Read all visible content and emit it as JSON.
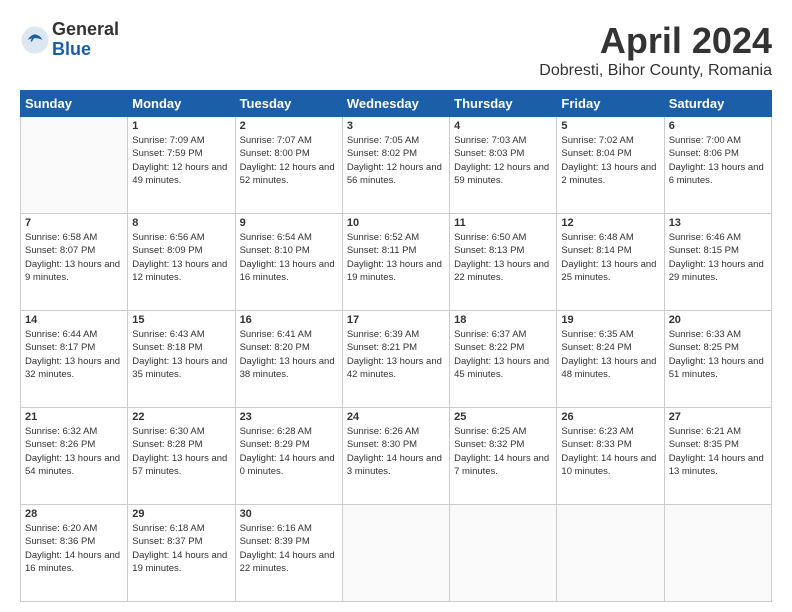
{
  "header": {
    "logo_general": "General",
    "logo_blue": "Blue",
    "title": "April 2024",
    "location": "Dobresti, Bihor County, Romania"
  },
  "days_of_week": [
    "Sunday",
    "Monday",
    "Tuesday",
    "Wednesday",
    "Thursday",
    "Friday",
    "Saturday"
  ],
  "weeks": [
    [
      {
        "day": "",
        "sunrise": "",
        "sunset": "",
        "daylight": ""
      },
      {
        "day": "1",
        "sunrise": "Sunrise: 7:09 AM",
        "sunset": "Sunset: 7:59 PM",
        "daylight": "Daylight: 12 hours and 49 minutes."
      },
      {
        "day": "2",
        "sunrise": "Sunrise: 7:07 AM",
        "sunset": "Sunset: 8:00 PM",
        "daylight": "Daylight: 12 hours and 52 minutes."
      },
      {
        "day": "3",
        "sunrise": "Sunrise: 7:05 AM",
        "sunset": "Sunset: 8:02 PM",
        "daylight": "Daylight: 12 hours and 56 minutes."
      },
      {
        "day": "4",
        "sunrise": "Sunrise: 7:03 AM",
        "sunset": "Sunset: 8:03 PM",
        "daylight": "Daylight: 12 hours and 59 minutes."
      },
      {
        "day": "5",
        "sunrise": "Sunrise: 7:02 AM",
        "sunset": "Sunset: 8:04 PM",
        "daylight": "Daylight: 13 hours and 2 minutes."
      },
      {
        "day": "6",
        "sunrise": "Sunrise: 7:00 AM",
        "sunset": "Sunset: 8:06 PM",
        "daylight": "Daylight: 13 hours and 6 minutes."
      }
    ],
    [
      {
        "day": "7",
        "sunrise": "Sunrise: 6:58 AM",
        "sunset": "Sunset: 8:07 PM",
        "daylight": "Daylight: 13 hours and 9 minutes."
      },
      {
        "day": "8",
        "sunrise": "Sunrise: 6:56 AM",
        "sunset": "Sunset: 8:09 PM",
        "daylight": "Daylight: 13 hours and 12 minutes."
      },
      {
        "day": "9",
        "sunrise": "Sunrise: 6:54 AM",
        "sunset": "Sunset: 8:10 PM",
        "daylight": "Daylight: 13 hours and 16 minutes."
      },
      {
        "day": "10",
        "sunrise": "Sunrise: 6:52 AM",
        "sunset": "Sunset: 8:11 PM",
        "daylight": "Daylight: 13 hours and 19 minutes."
      },
      {
        "day": "11",
        "sunrise": "Sunrise: 6:50 AM",
        "sunset": "Sunset: 8:13 PM",
        "daylight": "Daylight: 13 hours and 22 minutes."
      },
      {
        "day": "12",
        "sunrise": "Sunrise: 6:48 AM",
        "sunset": "Sunset: 8:14 PM",
        "daylight": "Daylight: 13 hours and 25 minutes."
      },
      {
        "day": "13",
        "sunrise": "Sunrise: 6:46 AM",
        "sunset": "Sunset: 8:15 PM",
        "daylight": "Daylight: 13 hours and 29 minutes."
      }
    ],
    [
      {
        "day": "14",
        "sunrise": "Sunrise: 6:44 AM",
        "sunset": "Sunset: 8:17 PM",
        "daylight": "Daylight: 13 hours and 32 minutes."
      },
      {
        "day": "15",
        "sunrise": "Sunrise: 6:43 AM",
        "sunset": "Sunset: 8:18 PM",
        "daylight": "Daylight: 13 hours and 35 minutes."
      },
      {
        "day": "16",
        "sunrise": "Sunrise: 6:41 AM",
        "sunset": "Sunset: 8:20 PM",
        "daylight": "Daylight: 13 hours and 38 minutes."
      },
      {
        "day": "17",
        "sunrise": "Sunrise: 6:39 AM",
        "sunset": "Sunset: 8:21 PM",
        "daylight": "Daylight: 13 hours and 42 minutes."
      },
      {
        "day": "18",
        "sunrise": "Sunrise: 6:37 AM",
        "sunset": "Sunset: 8:22 PM",
        "daylight": "Daylight: 13 hours and 45 minutes."
      },
      {
        "day": "19",
        "sunrise": "Sunrise: 6:35 AM",
        "sunset": "Sunset: 8:24 PM",
        "daylight": "Daylight: 13 hours and 48 minutes."
      },
      {
        "day": "20",
        "sunrise": "Sunrise: 6:33 AM",
        "sunset": "Sunset: 8:25 PM",
        "daylight": "Daylight: 13 hours and 51 minutes."
      }
    ],
    [
      {
        "day": "21",
        "sunrise": "Sunrise: 6:32 AM",
        "sunset": "Sunset: 8:26 PM",
        "daylight": "Daylight: 13 hours and 54 minutes."
      },
      {
        "day": "22",
        "sunrise": "Sunrise: 6:30 AM",
        "sunset": "Sunset: 8:28 PM",
        "daylight": "Daylight: 13 hours and 57 minutes."
      },
      {
        "day": "23",
        "sunrise": "Sunrise: 6:28 AM",
        "sunset": "Sunset: 8:29 PM",
        "daylight": "Daylight: 14 hours and 0 minutes."
      },
      {
        "day": "24",
        "sunrise": "Sunrise: 6:26 AM",
        "sunset": "Sunset: 8:30 PM",
        "daylight": "Daylight: 14 hours and 3 minutes."
      },
      {
        "day": "25",
        "sunrise": "Sunrise: 6:25 AM",
        "sunset": "Sunset: 8:32 PM",
        "daylight": "Daylight: 14 hours and 7 minutes."
      },
      {
        "day": "26",
        "sunrise": "Sunrise: 6:23 AM",
        "sunset": "Sunset: 8:33 PM",
        "daylight": "Daylight: 14 hours and 10 minutes."
      },
      {
        "day": "27",
        "sunrise": "Sunrise: 6:21 AM",
        "sunset": "Sunset: 8:35 PM",
        "daylight": "Daylight: 14 hours and 13 minutes."
      }
    ],
    [
      {
        "day": "28",
        "sunrise": "Sunrise: 6:20 AM",
        "sunset": "Sunset: 8:36 PM",
        "daylight": "Daylight: 14 hours and 16 minutes."
      },
      {
        "day": "29",
        "sunrise": "Sunrise: 6:18 AM",
        "sunset": "Sunset: 8:37 PM",
        "daylight": "Daylight: 14 hours and 19 minutes."
      },
      {
        "day": "30",
        "sunrise": "Sunrise: 6:16 AM",
        "sunset": "Sunset: 8:39 PM",
        "daylight": "Daylight: 14 hours and 22 minutes."
      },
      {
        "day": "",
        "sunrise": "",
        "sunset": "",
        "daylight": ""
      },
      {
        "day": "",
        "sunrise": "",
        "sunset": "",
        "daylight": ""
      },
      {
        "day": "",
        "sunrise": "",
        "sunset": "",
        "daylight": ""
      },
      {
        "day": "",
        "sunrise": "",
        "sunset": "",
        "daylight": ""
      }
    ]
  ]
}
